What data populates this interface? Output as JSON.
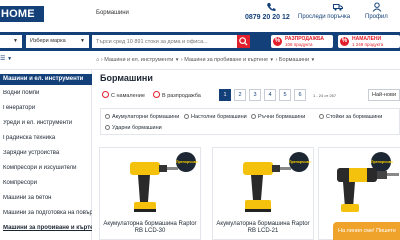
{
  "header": {
    "logo_text": "HOME",
    "top_category": "Бормашини",
    "phone": "0879 20 20 12",
    "links": [
      {
        "label": "Проследи поръчка",
        "icon": "truck-icon"
      },
      {
        "label": "Профил",
        "icon": "user-icon"
      }
    ]
  },
  "search": {
    "category_value": "",
    "brand_value": "Избери марка",
    "placeholder": "Търси сред 10 891 стоки за дома и офиса...",
    "promos": [
      {
        "title": "РАЗПРОДАЖБА",
        "subtitle": "106 продукта"
      },
      {
        "title": "НАМАЛЕНИ",
        "subtitle": "1 249 продукта"
      }
    ]
  },
  "nav": {
    "menu_label": "",
    "breadcrumbs": [
      "Машини и ел. инструменти",
      "Машини за пробиване и къртене",
      "Бормашини"
    ]
  },
  "sidebar": {
    "heading": "Машини и ел. инструменти",
    "items": [
      {
        "label": "Водни помпи",
        "active": false
      },
      {
        "label": "Генератори",
        "active": false
      },
      {
        "label": "Уреди и ел. инструменти",
        "active": false
      },
      {
        "label": "Градинска техника",
        "active": false
      },
      {
        "label": "Зарядни устройства",
        "active": false
      },
      {
        "label": "Компресори и изсушители",
        "active": false
      },
      {
        "label": "Компресори",
        "active": false
      },
      {
        "label": "Машини за бетон",
        "active": false
      },
      {
        "label": "Машини за подготовка на повърхности",
        "active": false
      },
      {
        "label": "Машини за пробиване и къртене",
        "active": true
      }
    ]
  },
  "main": {
    "title": "Бормашини",
    "chips": [
      {
        "label": "С намаление"
      },
      {
        "label": "В разпродажба"
      }
    ],
    "pages": [
      "1",
      "2",
      "3",
      "4",
      "5",
      "6"
    ],
    "pagination_info": "1 - 24 от 267",
    "sort_label": "Най-нови",
    "filters": [
      "Акумулаторни бормашини",
      "Настолни бормашини",
      "Ръчни бормашини",
      "Стойки за бормашини",
      "Ударни бормашини"
    ],
    "products": [
      {
        "name": "Акумулаторна бормашина Raptor RB LCD-30",
        "badge": "Препоръчан"
      },
      {
        "name": "Акумулаторна бормашина Raptor RB LCD-21",
        "badge": "Препоръчан"
      },
      {
        "name": "",
        "badge": "Препоръчан"
      }
    ]
  },
  "chat": {
    "label": "На линия сме! Пишете"
  },
  "colors": {
    "brand": "#14407a",
    "accent": "#e2202b",
    "chat": "#f0a32b",
    "product_yellow": "#f4c20d"
  }
}
